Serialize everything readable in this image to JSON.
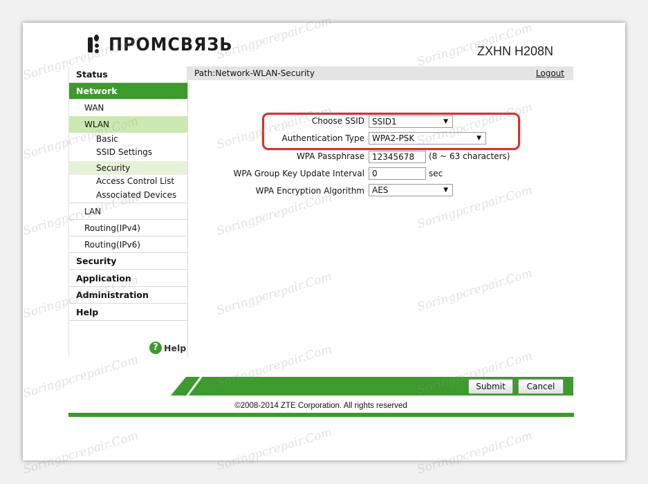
{
  "brand": {
    "name": "ПРОМСВЯЗЬ",
    "model": "ZXHN H208N"
  },
  "path": {
    "text": "Path:Network-WLAN-Security",
    "logout": "Logout"
  },
  "sidebar": {
    "status": "Status",
    "network": "Network",
    "wan": "WAN",
    "wlan": "WLAN",
    "basic": "Basic",
    "ssid_settings": "SSID Settings",
    "security_sub": "Security",
    "acl": "Access Control List",
    "associated": "Associated Devices",
    "lan": "LAN",
    "routing_v4": "Routing(IPv4)",
    "routing_v6": "Routing(IPv6)",
    "security": "Security",
    "application": "Application",
    "administration": "Administration",
    "help": "Help",
    "help_button": "Help"
  },
  "form": {
    "choose_ssid_label": "Choose SSID",
    "choose_ssid_value": "SSID1",
    "auth_type_label": "Authentication Type",
    "auth_type_value": "WPA2-PSK",
    "passphrase_label": "WPA Passphrase",
    "passphrase_value": "12345678",
    "passphrase_hint": "(8 ~ 63 characters)",
    "group_key_label": "WPA Group Key Update Interval",
    "group_key_value": "0",
    "group_key_unit": "sec",
    "encryption_label": "WPA Encryption Algorithm",
    "encryption_value": "AES"
  },
  "buttons": {
    "submit": "Submit",
    "cancel": "Cancel"
  },
  "footer": {
    "copyright": "©2008-2014 ZTE Corporation. All rights reserved"
  },
  "watermark": "Soringpcrepair.Com",
  "colors": {
    "accent_green": "#3d9a2c",
    "highlight_red": "#d63031"
  }
}
